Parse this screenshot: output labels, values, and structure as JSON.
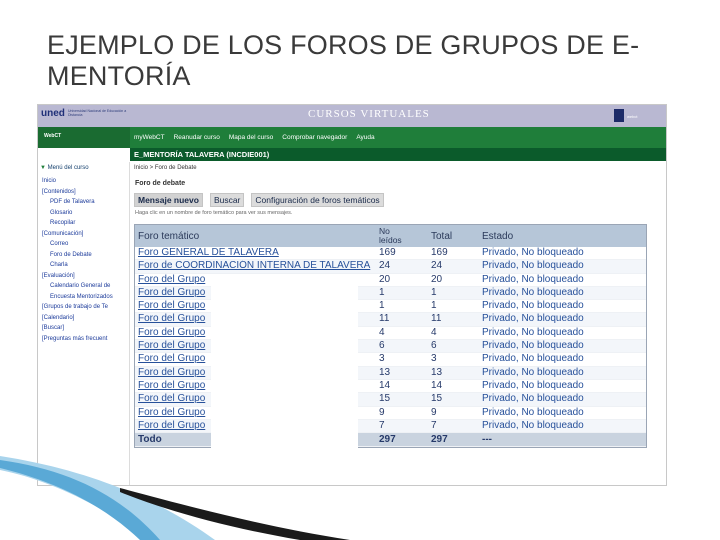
{
  "slide": {
    "title_line1": "EJEMPLO DE LOS FOROS DE GRUPOS DE E-",
    "title_line2": "MENTORÍA"
  },
  "banner": {
    "logo": "uned",
    "logo_sub": "Universidad Nacional de Educación a Distancia",
    "title": "CURSOS VIRTUALES",
    "right_text": "webct"
  },
  "nav": {
    "badge": "WebCT",
    "items": [
      "myWebCT",
      "Reanudar curso",
      "Mapa del curso",
      "Comprobar navegador",
      "Ayuda"
    ]
  },
  "course": {
    "title": "E_MENTORÍA TALAVERA (INCDIE001)"
  },
  "sidebar": {
    "menu_label": "Menú del curso",
    "items": [
      {
        "label": "Inicio",
        "indent": false
      },
      {
        "label": "[Contenidos]",
        "indent": false
      },
      {
        "label": "PDF de Talavera",
        "indent": true
      },
      {
        "label": "Glosario",
        "indent": true
      },
      {
        "label": "Recopilar",
        "indent": true
      },
      {
        "label": "[Comunicación]",
        "indent": false
      },
      {
        "label": "Correo",
        "indent": true
      },
      {
        "label": "Foro de Debate",
        "indent": true
      },
      {
        "label": "Charla",
        "indent": true
      },
      {
        "label": "[Evaluación]",
        "indent": false
      },
      {
        "label": "Calendario General de",
        "indent": true
      },
      {
        "label": "Encuesta Mentorizados",
        "indent": true
      },
      {
        "label": "[Grupos de trabajo de Te",
        "indent": false
      },
      {
        "label": "[Calendario]",
        "indent": false
      },
      {
        "label": "[Buscar]",
        "indent": false
      },
      {
        "label": "[Preguntas más frecuent",
        "indent": false
      }
    ]
  },
  "breadcrumb": "Inicio  >  Foro de Debate",
  "section_title": "Foro de debate",
  "toolbar": {
    "new_message": "Mensaje nuevo",
    "search": "Buscar",
    "config": "Configuración de foros temáticos"
  },
  "hint": "Haga clic en un nombre de foro temático para ver sus mensajes.",
  "table": {
    "headers": {
      "topic": "Foro temático",
      "unread_line1": "No",
      "unread_line2": "leídos",
      "total": "Total",
      "state": "Estado"
    },
    "rows": [
      {
        "topic": "Foro GENERAL DE TALAVERA",
        "unread": "169",
        "total": "169",
        "state": "Privado, No bloqueado"
      },
      {
        "topic": "Foro de COORDINACIÓN INTERNA DE TALAVERA",
        "unread": "24",
        "total": "24",
        "state": "Privado, No bloqueado"
      },
      {
        "topic": "Foro del Grupo",
        "unread": "20",
        "total": "20",
        "state": "Privado, No bloqueado"
      },
      {
        "topic": "Foro del Grupo",
        "unread": "1",
        "total": "1",
        "state": "Privado, No bloqueado"
      },
      {
        "topic": "Foro del Grupo",
        "unread": "1",
        "total": "1",
        "state": "Privado, No bloqueado"
      },
      {
        "topic": "Foro del Grupo",
        "unread": "11",
        "total": "11",
        "state": "Privado, No bloqueado"
      },
      {
        "topic": "Foro del Grupo",
        "unread": "4",
        "total": "4",
        "state": "Privado, No bloqueado"
      },
      {
        "topic": "Foro del Grupo",
        "unread": "6",
        "total": "6",
        "state": "Privado, No bloqueado"
      },
      {
        "topic": "Foro del Grupo",
        "unread": "3",
        "total": "3",
        "state": "Privado, No bloqueado"
      },
      {
        "topic": "Foro del Grupo",
        "unread": "13",
        "total": "13",
        "state": "Privado, No bloqueado"
      },
      {
        "topic": "Foro del Grupo",
        "unread": "14",
        "total": "14",
        "state": "Privado, No bloqueado"
      },
      {
        "topic": "Foro del Grupo",
        "unread": "15",
        "total": "15",
        "state": "Privado, No bloqueado"
      },
      {
        "topic": "Foro del Grupo",
        "unread": "9",
        "total": "9",
        "state": "Privado, No bloqueado"
      },
      {
        "topic": "Foro del Grupo",
        "unread": "7",
        "total": "7",
        "state": "Privado, No bloqueado"
      }
    ],
    "footer": {
      "topic": "Todo",
      "unread": "297",
      "total": "297",
      "state": "---"
    }
  },
  "colors": {
    "banner": "#b9b8d2",
    "nav": "#1f7e3a",
    "course_bar": "#0b5b2b",
    "table_header": "#b6c6d8",
    "link": "#26509a"
  },
  "icons": {
    "menu_toggle": "triangle-down-icon",
    "decoration": "swoosh-decoration"
  }
}
